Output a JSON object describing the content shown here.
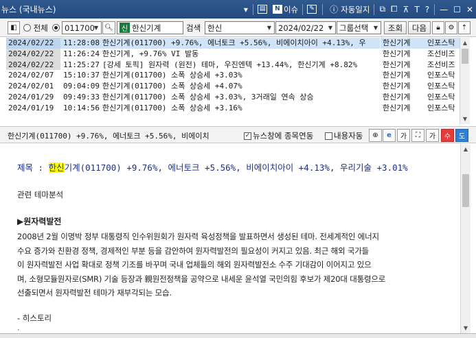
{
  "window": {
    "title": "뉴스 (국내뉴스)",
    "n_label": "N",
    "issue_label": "이슈",
    "autojournal_label": "자동일지",
    "question_label": "?"
  },
  "toolbar": {
    "all_label": "전체",
    "code_value": "011700",
    "shin_badge": "신",
    "stock_name": "한신기계",
    "search_label": "검색",
    "search_value": "한신",
    "date_value": "2024/02/22",
    "group_select": "그룹선택",
    "query_button": "조회",
    "next_button": "다음"
  },
  "news_rows": [
    {
      "date": "2024/02/22",
      "time": "11:28:08",
      "title": "한신기계(011700)  +9.76%, 에너토크 +5.56%, 비에이치아이 +4.13%, 우",
      "source": "한신기계",
      "category": "인포스탁",
      "selected": true
    },
    {
      "date": "2024/02/22",
      "time": "11:26:24",
      "title": "한신기계, +9.76% VI 발동",
      "source": "한신기계",
      "category": "조선비즈",
      "selected": false
    },
    {
      "date": "2024/02/22",
      "time": "11:25:27",
      "title": "[강세 토픽] 원자력 (원전) 테마, 우진엔텍 +13.44%, 한신기계 +8.82%",
      "source": "한신기계",
      "category": "조선비즈",
      "selected": false
    },
    {
      "date": "2024/02/07",
      "time": "15:10:37",
      "title": "한신기계(011700) 소폭 상승세 +3.03%",
      "source": "한신기계",
      "category": "인포스탁",
      "selected": false
    },
    {
      "date": "2024/02/01",
      "time": "09:04:09",
      "title": "한신기계(011700) 소폭 상승세 +4.07%",
      "source": "한신기계",
      "category": "인포스탁",
      "selected": false
    },
    {
      "date": "2024/01/29",
      "time": "09:49:33",
      "title": "한신기계(011700) 소폭 상승세 +3.03%, 3거래일 연속 상승",
      "source": "한신기계",
      "category": "인포스탁",
      "selected": false
    },
    {
      "date": "2024/01/19",
      "time": "10:14:56",
      "title": "한신기계(011700) 소폭 상승세 +3.16%",
      "source": "한신기계",
      "category": "인포스탁",
      "selected": false
    }
  ],
  "detailbar": {
    "headline": "한신기계(011700)  +9.76%, 에너토크 +5.56%, 비에이치",
    "link_label": "뉴스창에 종목연동",
    "content_label": "내용자동",
    "font_up_label": "가",
    "font_down_label": "가",
    "red_button": "수",
    "blue_button": "도"
  },
  "article": {
    "subject_prefix": "제목 : ",
    "subject_highlight": "한신",
    "subject_rest": "기계(011700) +9.76%, 에너토크 +5.56%, 비에이치아이 +4.13%, 우리기술 +3.01%",
    "related": "관련 테마분석",
    "section_title": "▶원자력발전",
    "lines": [
      "2008년 2월 이명박 정부 대통령직 인수위원회가 원자력 육성정책을 발표하면서 생성된 테마. 전세계적인 에너지",
      "수요 증가와 친환경 정책, 경제적인 부분 등을 감안하여 원자력발전의 필요성이 커지고 있음. 최근 해외 국가들",
      "이 원자력발전 사업 확대로 정책 기조를 바꾸며 국내 업체들의 해외 원자력발전소 수주 기대감이 이어지고 있으",
      "며, 소형모듈원자로(SMR) 기술 등장과 親원전정책을 공약으로 내세운 윤석열 국민의힘 후보가 제20대 대통령으로",
      "선출되면서 원자력발전 테마가 재부각되는 모습."
    ],
    "history_label": "- 히스토리"
  },
  "colors": {
    "titlebar": "#234b80",
    "selected_row": "#cfe4f8",
    "subject_text": "#1c2f8a",
    "highlight": "#ffff00",
    "red_button": "#e23d3d",
    "blue_button": "#2f7fd8"
  }
}
